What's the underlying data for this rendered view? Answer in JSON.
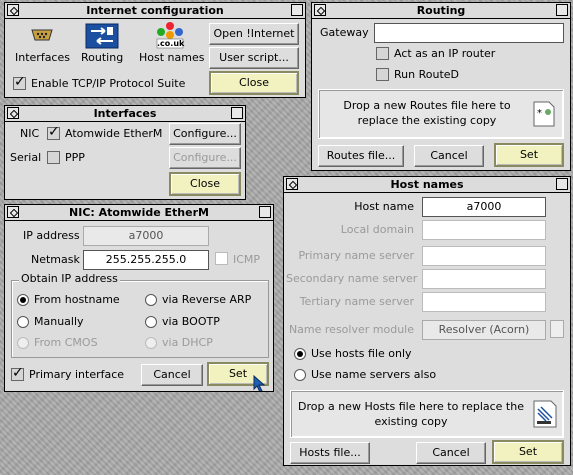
{
  "internet_config": {
    "title": "Internet configuration",
    "icons": [
      {
        "label": "Interfaces",
        "icon": "interfaces-icon"
      },
      {
        "label": "Routing",
        "icon": "routing-icon"
      },
      {
        "label": "Host names",
        "icon": "hostnames-icon"
      }
    ],
    "hostnames_icon_text": ".co.uk",
    "open_internet": "Open !Internet",
    "user_script": "User script...",
    "enable_tcpip": "Enable TCP/IP Protocol Suite",
    "enable_tcpip_checked": true,
    "close": "Close"
  },
  "routing": {
    "title": "Routing",
    "gateway_label": "Gateway",
    "gateway_value": "",
    "act_as_router": "Act as an IP router",
    "run_routed": "Run RouteD",
    "drop_text": "Drop a new Routes file here to replace the existing copy",
    "routes_file": "Routes file...",
    "cancel": "Cancel",
    "set": "Set"
  },
  "interfaces": {
    "title": "Interfaces",
    "nic_label": "NIC",
    "nic_checked": true,
    "nic_name": "Atomwide EtherM",
    "configure": "Configure...",
    "serial_label": "Serial",
    "serial_checked": false,
    "serial_name": "PPP",
    "close": "Close"
  },
  "nic": {
    "title": "NIC: Atomwide EtherM",
    "ip_label": "IP address",
    "ip_value": "a7000",
    "netmask_label": "Netmask",
    "netmask_value": "255.255.255.0",
    "icmp_label": "ICMP",
    "obtain_label": "Obtain IP address",
    "options": [
      {
        "label": "From hostname",
        "selected": true,
        "enabled": true
      },
      {
        "label": "via Reverse ARP",
        "selected": false,
        "enabled": true
      },
      {
        "label": "Manually",
        "selected": false,
        "enabled": true
      },
      {
        "label": "via BOOTP",
        "selected": false,
        "enabled": true
      },
      {
        "label": "From CMOS",
        "selected": false,
        "enabled": false
      },
      {
        "label": "via DHCP",
        "selected": false,
        "enabled": false
      }
    ],
    "primary_label": "Primary interface",
    "primary_checked": true,
    "cancel": "Cancel",
    "set": "Set"
  },
  "hostnames": {
    "title": "Host names",
    "host_name_label": "Host name",
    "host_name_value": "a7000",
    "local_domain_label": "Local domain",
    "primary_ns_label": "Primary name server",
    "secondary_ns_label": "Secondary name server",
    "tertiary_ns_label": "Tertiary name server",
    "resolver_label": "Name resolver module",
    "resolver_value": "Resolver (Acorn)",
    "use_hosts_file": "Use hosts file only",
    "use_name_servers": "Use name servers also",
    "drop_text": "Drop a new Hosts file here to replace the existing copy",
    "hosts_file": "Hosts file...",
    "cancel": "Cancel",
    "set": "Set"
  }
}
